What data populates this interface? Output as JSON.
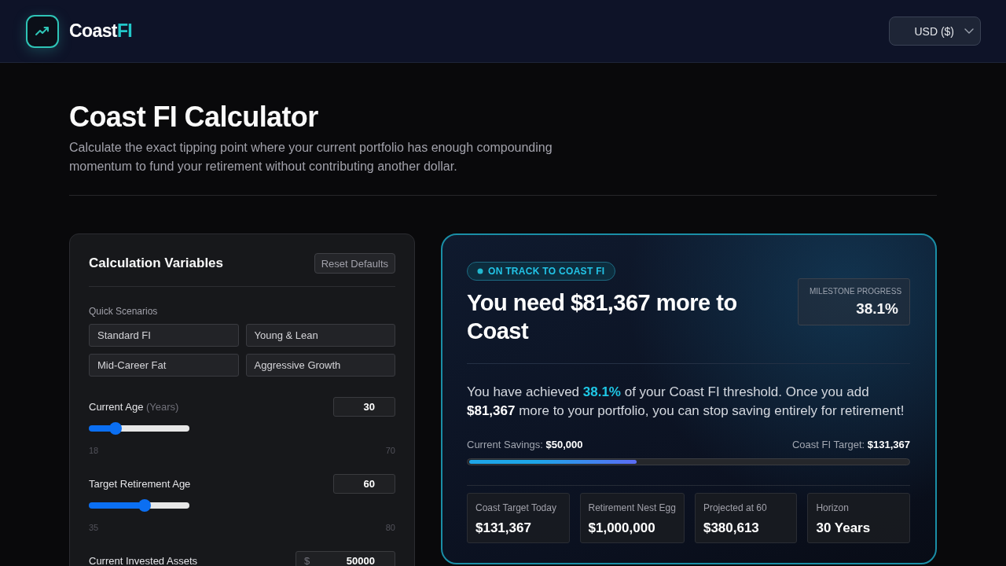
{
  "header": {
    "logo": {
      "name": "Coast",
      "accent": "FI"
    },
    "currency_select": {
      "value": "USD ($)"
    }
  },
  "intro": {
    "title": "Coast FI Calculator",
    "subtitle": "Calculate the exact tipping point where your current portfolio has enough compounding momentum to fund your retirement without contributing another dollar."
  },
  "variables_panel": {
    "title": "Calculation Variables",
    "reset_button": "Reset Defaults",
    "scenarios_label": "Quick Scenarios",
    "scenarios": [
      "Standard FI",
      "Young & Lean",
      "Mid-Career Fat",
      "Aggressive Growth"
    ],
    "fields": [
      {
        "kind": "slider",
        "label": "Current Age",
        "unit": "(Years)",
        "value": "30",
        "level": 0.23,
        "min": "18",
        "max": "70"
      },
      {
        "kind": "slider",
        "label": "Target Retirement Age",
        "value": "60",
        "level": 0.56,
        "min": "35",
        "max": "80"
      },
      {
        "kind": "currency",
        "label": "Current Invested Assets",
        "prefix": "$",
        "value": "50000"
      }
    ]
  },
  "results_panel": {
    "status_badge": "ON TRACK TO COAST FI",
    "headline": "You need $81,367 more to Coast",
    "milestone": {
      "label": "MILESTONE PROGRESS",
      "value": "38.1%"
    },
    "summary": "You have achieved **38.1%** of your Coast FI threshold. Once you add **$81,367** more to your portfolio, you can stop saving entirely for retirement!",
    "progress": {
      "current": "Current Savings: **$50,000**",
      "target": "Coast FI Target: **$131,367**",
      "level": 0.381
    },
    "stats": [
      {
        "label": "Coast Target Today",
        "value": "$131,367"
      },
      {
        "label": "Retirement Nest Egg",
        "value": "$1,000,000"
      },
      {
        "label": "Projected at 60",
        "value": "$380,613"
      },
      {
        "label": "Horizon",
        "value": "30 Years"
      }
    ]
  }
}
